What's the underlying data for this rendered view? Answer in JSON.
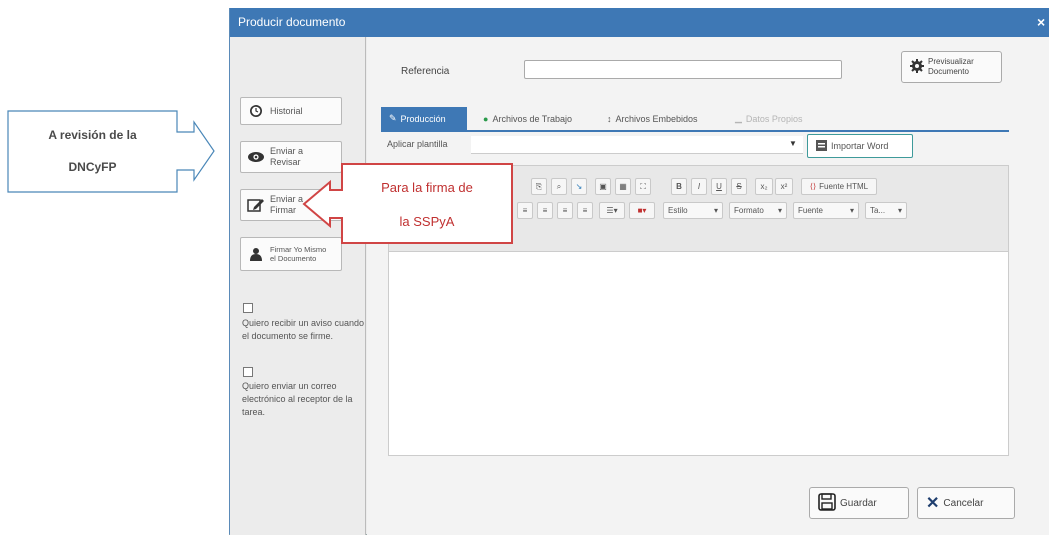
{
  "window": {
    "title": "Producir documento",
    "close_glyph": "×"
  },
  "sidebar": {
    "buttons": [
      {
        "label": "Historial",
        "icon": "clock-icon"
      },
      {
        "label": "Enviar a\nRevisar",
        "icon": "eye-icon"
      },
      {
        "label": "Enviar a\nFirmar",
        "icon": "edit-icon"
      },
      {
        "label": "Firmar Yo Mismo\nel Documento",
        "icon": "user-icon"
      }
    ],
    "notify_sign_text": "Quiero recibir un aviso cuando el documento se firme.",
    "notify_email_text": "Quiero enviar un correo electrónico al receptor de la tarea."
  },
  "form": {
    "referencia_label": "Referencia",
    "referencia_value": "",
    "preview_button": "Previsualizar\nDocumento",
    "tabs": [
      {
        "label": "Producción",
        "active": true
      },
      {
        "label": "Archivos de Trabajo",
        "active": false
      },
      {
        "label": "Archivos Embebidos",
        "active": false
      },
      {
        "label": "Datos Propios",
        "active": false
      }
    ],
    "aplicar_plantilla_label": "Aplicar plantilla",
    "import_word_button": "Importar Word"
  },
  "editor_toolbar": {
    "row1_format_buttons": [
      "B",
      "I",
      "U",
      "S",
      "x₂",
      "x²"
    ],
    "source_button": "Fuente HTML",
    "estilo": "Estilo",
    "formato": "Formato",
    "fuente": "Fuente",
    "tamano": "Ta..."
  },
  "footer": {
    "save_button": "Guardar",
    "cancel_button": "Cancelar"
  },
  "annotations": {
    "left_line1": "A revisión de la",
    "left_line2": "DNCyFP",
    "red_line1": "Para la firma de",
    "red_line2": "la SSPyA"
  },
  "colors": {
    "titlebar": "#3e78b5",
    "accent_red": "#d04545",
    "annotation_blue": "#4a87b8"
  }
}
